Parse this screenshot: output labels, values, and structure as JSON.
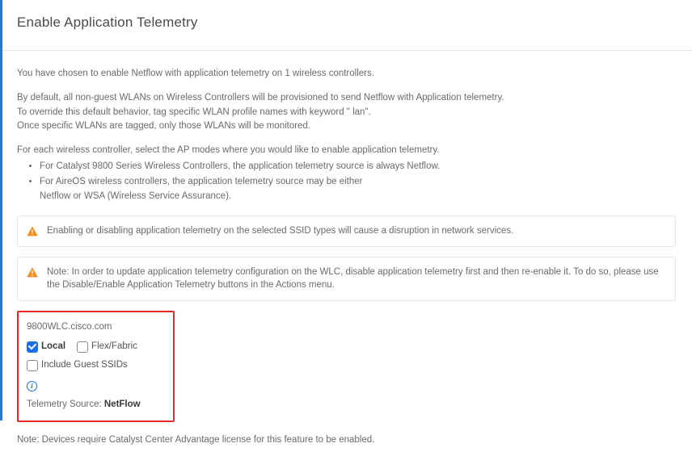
{
  "header": {
    "title": "Enable Application Telemetry"
  },
  "intro": {
    "line1": "You have chosen to enable Netflow with application telemetry on 1 wireless controllers.",
    "para2_l1": "By default, all non-guest WLANs on Wireless Controllers will be provisioned to send Netflow with Application telemetry.",
    "para2_l2": "To override this default behavior, tag specific WLAN profile names with keyword \" lan\".",
    "para2_l3": "Once specific WLANs are tagged, only those WLANs will be monitored.",
    "line3": "For each wireless controller, select the AP modes where you would like to enable application telemetry.",
    "bullet1": "For Catalyst 9800 Series Wireless Controllers, the application telemetry source is always Netflow.",
    "bullet2a": "For AireOS wireless controllers, the application telemetry source may be either",
    "bullet2b": "Netflow or WSA (Wireless Service Assurance)."
  },
  "alerts": {
    "disruption": "Enabling or disabling application telemetry on the selected SSID types will cause a disruption in network services.",
    "update_note": "Note: In order to update application telemetry configuration on the WLC, disable application telemetry first and then re-enable it. To do so, please use the Disable/Enable Application Telemetry buttons in the Actions menu."
  },
  "wlc": {
    "name": "9800WLC.cisco.com",
    "local_label": "Local",
    "flex_label": "Flex/Fabric",
    "guest_label": "Include Guest SSIDs",
    "source_label": "Telemetry Source: ",
    "source_value": "NetFlow"
  },
  "footer": {
    "note": "Note: Devices require Catalyst Center Advantage license for this feature to be enabled."
  }
}
